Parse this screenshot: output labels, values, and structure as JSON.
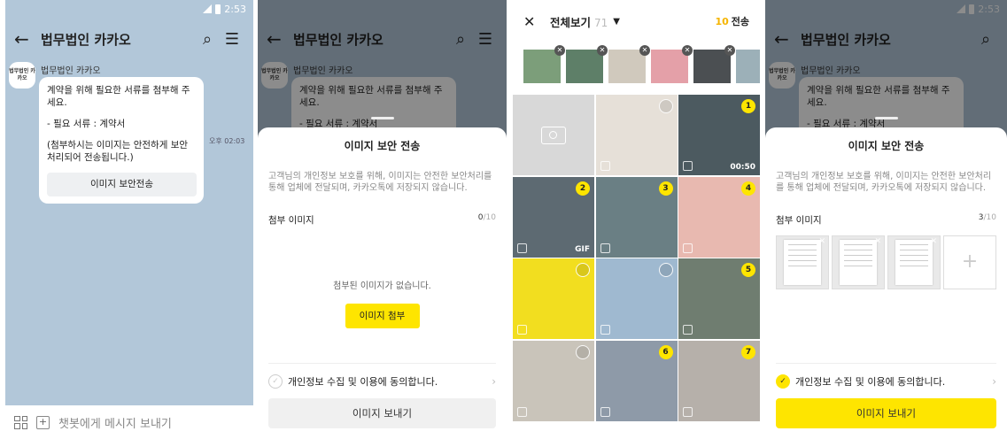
{
  "status": {
    "time": "2:53"
  },
  "chat": {
    "title": "법무법인 카카오",
    "profile_text": "법무법인 카카오",
    "sender": "법무법인 카카오",
    "message_lines": [
      "계약을 위해 필요한 서류를 첨부해 주세요.",
      "- 필요 서류 : 계약서",
      "(첨부하시는 이미지는 안전하게 보안 처리되어 전송됩니다.)"
    ],
    "button_label": "이미지 보안전송",
    "time": "오후 02:03",
    "input_placeholder": "챗봇에게 메시지 보내기"
  },
  "sheet": {
    "title": "이미지 보안 전송",
    "description": "고객님의 개인정보 보호를 위해, 이미지는 안전한 보안처리를 통해 업체에 전달되며, 카카오톡에 저장되지 않습니다.",
    "attach_label": "첨부 이미지",
    "count_empty": "0",
    "count_filled": "3",
    "count_max": "/10",
    "empty_text": "첨부된 이미지가 없습니다.",
    "attach_button": "이미지 첨부",
    "agree_text": "개인정보 수집 및 이용에 동의합니다.",
    "send_button": "이미지 보내기"
  },
  "gallery": {
    "title": "전체보기",
    "count": "71",
    "send_count": "10",
    "send_label": "전송",
    "cells": [
      {
        "kind": "camera"
      },
      {
        "color": "#e6e0d8",
        "sel": ""
      },
      {
        "color": "#4c5a60",
        "sel": "1",
        "meta": "00:50"
      },
      {
        "color": "#5d6a72",
        "sel": "2",
        "meta": "GIF"
      },
      {
        "color": "#6a7f84",
        "sel": "3"
      },
      {
        "color": "#e8b9b0",
        "sel": "4"
      },
      {
        "color": "#f2de1f",
        "sel": ""
      },
      {
        "color": "#9fb9d0",
        "sel": ""
      },
      {
        "color": "#6f7d70",
        "sel": "5"
      },
      {
        "color": "#c9c4ba",
        "sel": ""
      },
      {
        "color": "#8e9aa8",
        "sel": "6"
      },
      {
        "color": "#b6b0aa",
        "sel": "7"
      }
    ],
    "strip_colors": [
      "#7c9e7a",
      "#5e7f68",
      "#d0c9bd",
      "#e4a0a8",
      "#4b4f52",
      "#9cb0b8"
    ]
  },
  "colors": {
    "accent": "#fee500",
    "chat_bg": "#b2c7d9"
  }
}
